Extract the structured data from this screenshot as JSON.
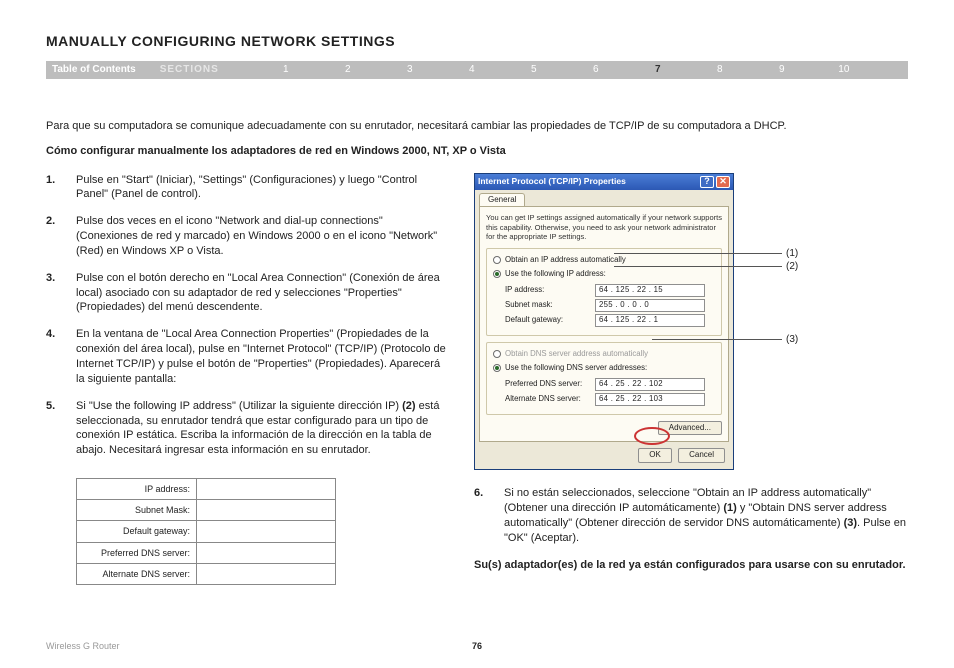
{
  "page": {
    "title": "MANUALLY CONFIGURING NETWORK SETTINGS",
    "footer_brand": "Wireless G Router",
    "page_number": "76"
  },
  "nav": {
    "toc": "Table of Contents",
    "sections_label": "SECTIONS",
    "items": [
      "1",
      "2",
      "3",
      "4",
      "5",
      "6",
      "7",
      "8",
      "9",
      "10"
    ],
    "active_index": 6
  },
  "intro": "Para que su computadora se comunique adecuadamente con su enrutador, necesitará cambiar las propiedades de TCP/IP de su computadora a DHCP.",
  "subhead": "Cómo configurar manualmente los adaptadores de red en Windows 2000, NT, XP o Vista",
  "steps": {
    "s1": "Pulse en \"Start\" (Iniciar), \"Settings\" (Configuraciones) y luego \"Control Panel\" (Panel de control).",
    "s2": "Pulse dos veces en el icono \"Network and dial-up connections\" (Conexiones de red y marcado) en Windows 2000 o en el icono \"Network\" (Red) en Windows XP o Vista.",
    "s3": "Pulse con el botón derecho en \"Local Area Connection\" (Conexión de área local) asociado con su adaptador de red y selecciones \"Properties\" (Propiedades) del menú descendente.",
    "s4": "En la ventana de \"Local Area Connection Properties\" (Propiedades de la conexión del área local), pulse en \"Internet Protocol\" (TCP/IP) (Protocolo de Internet TCP/IP) y pulse el botón de \"Properties\" (Propiedades). Aparecerá la siguiente pantalla:",
    "s5_pre": "Si \"Use the following IP address\" (Utilizar la siguiente dirección IP) ",
    "s5_bold": "(2)",
    "s5_post": " está seleccionada, su enrutador tendrá que estar configurado para un tipo de conexión IP estática. Escriba la información de la dirección en la tabla de abajo. Necesitará ingresar esta información en su enrutador.",
    "s6_pre": "Si no están seleccionados, seleccione \"Obtain an IP address automatically\" (Obtener una dirección IP automáticamente) ",
    "s6_b1": "(1)",
    "s6_mid": " y \"Obtain DNS server address automatically\" (Obtener dirección de servidor DNS automáticamente) ",
    "s6_b3": "(3)",
    "s6_post": ". Pulse en \"OK\" (Aceptar)."
  },
  "conclusion": "Su(s) adaptador(es) de la red ya están configurados para usarse con su enrutador.",
  "blank_table": {
    "r1": "IP address:",
    "r2": "Subnet Mask:",
    "r3": "Default gateway:",
    "r4": "Preferred DNS server:",
    "r5": "Alternate DNS server:"
  },
  "dialog": {
    "title": "Internet Protocol (TCP/IP) Properties",
    "tab": "General",
    "info": "You can get IP settings assigned automatically if your network supports this capability. Otherwise, you need to ask your network administrator for the appropriate IP settings.",
    "radio_auto_ip": "Obtain an IP address automatically",
    "radio_use_ip": "Use the following IP address:",
    "lbl_ip": "IP address:",
    "val_ip": "64 . 125 . 22 . 15",
    "lbl_mask": "Subnet mask:",
    "val_mask": "255 .  0  .  0  .  0",
    "lbl_gw": "Default gateway:",
    "val_gw": "64 . 125 . 22 .  1",
    "radio_auto_dns": "Obtain DNS server address automatically",
    "radio_use_dns": "Use the following DNS server addresses:",
    "lbl_pdns": "Preferred DNS server:",
    "val_pdns": "64 .  25 .  22 . 102",
    "lbl_adns": "Alternate DNS server:",
    "val_adns": "64 .  25 .  22 . 103",
    "btn_adv": "Advanced...",
    "btn_ok": "OK",
    "btn_cancel": "Cancel"
  },
  "callouts": {
    "c1": "(1)",
    "c2": "(2)",
    "c3": "(3)"
  }
}
